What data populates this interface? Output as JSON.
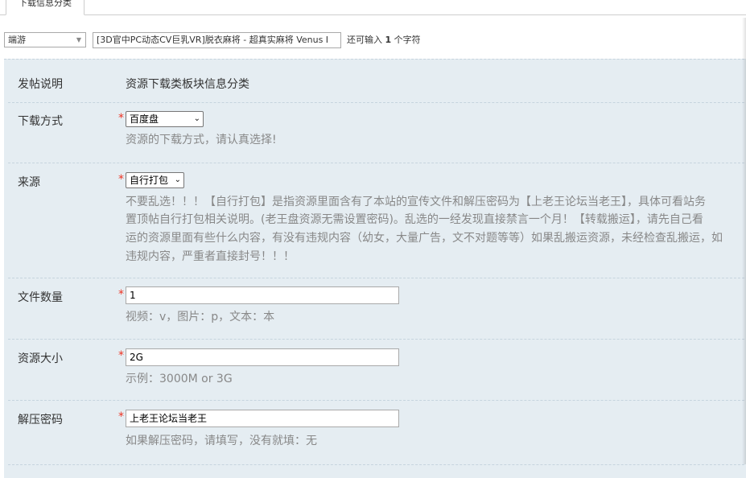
{
  "tab": {
    "label": "下载信息分类"
  },
  "subject": {
    "type_selected": "端游",
    "title_value": "[3D官中PC动态CV巨乳VR]脱衣麻将 - 超真实麻将 Venus I",
    "hint_prefix": "还可输入",
    "hint_count": "1",
    "hint_suffix": "个字符"
  },
  "form": {
    "post_desc": {
      "label": "发帖说明",
      "value": "资源下载类板块信息分类"
    },
    "download_method": {
      "label": "下载方式",
      "required": "*",
      "selected": "百度盘",
      "desc": "资源的下载方式，请认真选择!"
    },
    "source": {
      "label": "来源",
      "required": "*",
      "selected": "自行打包",
      "desc_lines": [
        "不要乱选！！！【自行打包】是指资源里面含有了本站的宣传文件和解压密码为【上老王论坛当老王】，具体可看站务",
        "置顶帖自行打包相关说明。(老王盘资源无需设置密码)。乱选的一经发现直接禁言一个月！【转载搬运】，请先自己看",
        "运的资源里面有些什么内容，有没有违规内容（幼女，大量广告，文不对题等等）如果乱搬运资源，未经检查乱搬运，如",
        "违规内容，严重者直接封号！！！"
      ]
    },
    "file_count": {
      "label": "文件数量",
      "required": "*",
      "value": "1",
      "desc": "视频：v，图片：p，文本：本"
    },
    "size": {
      "label": "资源大小",
      "required": "*",
      "value": "2G",
      "desc": "示例：3000M or 3G"
    },
    "password": {
      "label": "解压密码",
      "required": "*",
      "value": "上老王论坛当老王",
      "desc": "如果解压密码，请填写，没有就填：无"
    }
  }
}
